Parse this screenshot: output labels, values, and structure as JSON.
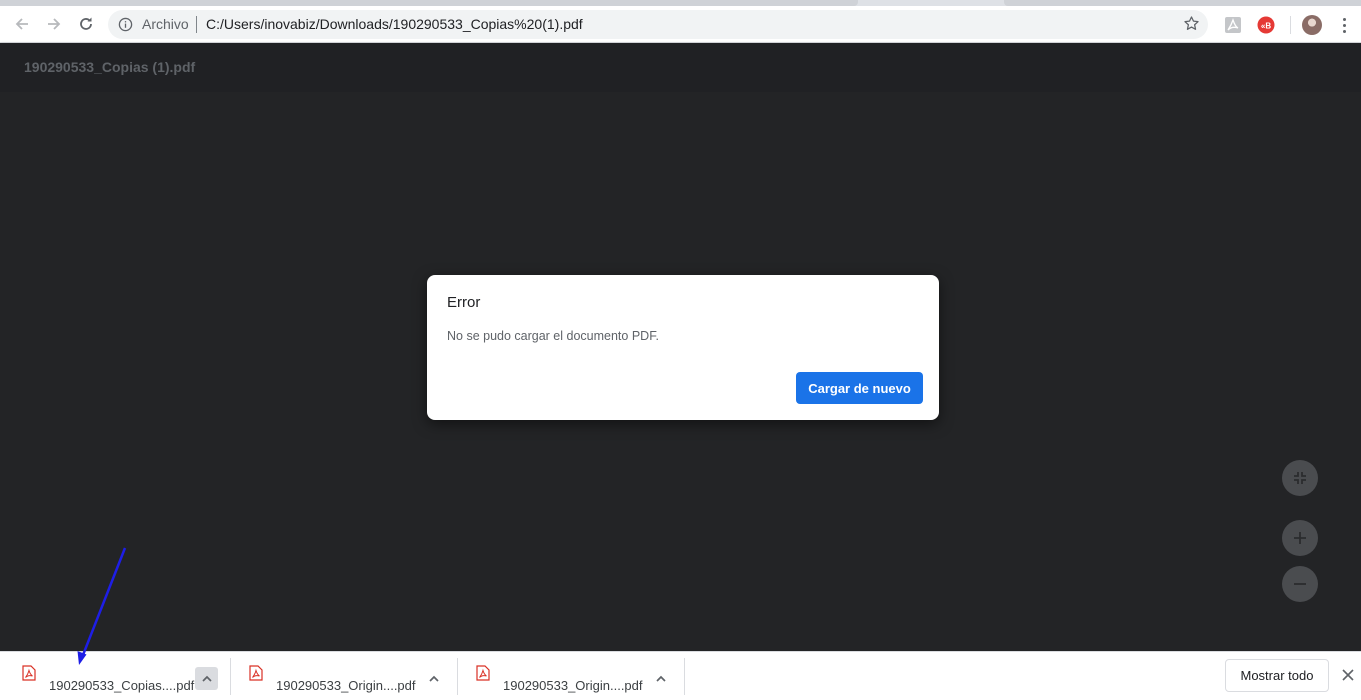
{
  "browser": {
    "omnibox": {
      "scheme_label": "Archivo",
      "url": "C:/Users/inovabiz/Downloads/190290533_Copias%20(1).pdf"
    },
    "icons": {
      "back": "arrow-left-icon",
      "forward": "arrow-right-icon",
      "reload": "reload-icon",
      "site_info": "info-icon",
      "bookmark": "star-icon",
      "ext_acrobat": "acrobat-icon",
      "ext_red": "extension-icon",
      "menu": "kebab-icon"
    },
    "colors": {
      "accent": "#1a73e8",
      "extension_red": "#e53935",
      "pdf_red": "#d93025"
    }
  },
  "pdf_viewer": {
    "title": "190290533_Copias (1).pdf"
  },
  "dialog": {
    "title": "Error",
    "message": "No se pudo cargar el documento PDF.",
    "button_label": "Cargar de nuevo"
  },
  "download_shelf": {
    "items": [
      {
        "name": "190290533_Copias....pdf"
      },
      {
        "name": "190290533_Origin....pdf"
      },
      {
        "name": "190290533_Origin....pdf"
      }
    ],
    "show_all_label": "Mostrar todo"
  }
}
